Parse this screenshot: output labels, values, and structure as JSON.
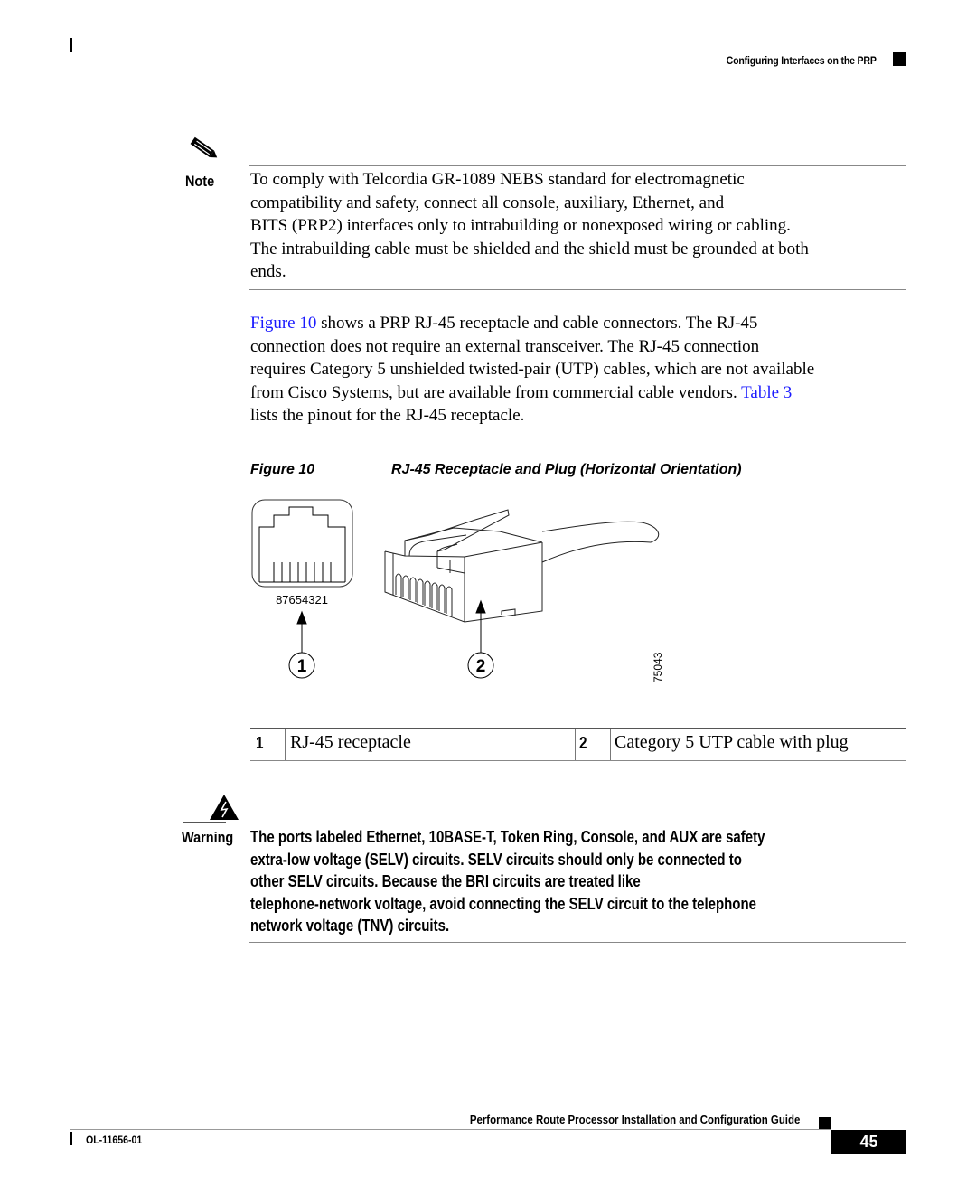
{
  "header": {
    "section_title": "Configuring Interfaces on the PRP"
  },
  "note": {
    "label": "Note",
    "icon": "pencil-icon",
    "lines": [
      "To comply with Telcordia GR-1089 NEBS standard for electromagnetic",
      "compatibility and safety, connect all console, auxiliary, Ethernet, and",
      "BITS (PRP2) interfaces only to intrabuilding or nonexposed wiring or cabling.",
      "The intrabuilding cable must be shielded and the shield must be grounded at both",
      "ends."
    ]
  },
  "paragraph": {
    "figure_link": "Figure 10",
    "line1_rest": " shows a PRP RJ-45 receptacle and cable connectors. The RJ-45",
    "line2": "connection does not require an external transceiver. The RJ-45 connection",
    "line3": "requires Category 5 unshielded twisted-pair (UTP) cables, which are not available",
    "line4_pre": "from Cisco Systems, but are available from commercial cable vendors. ",
    "table_link": "Table 3",
    "line5": "lists the pinout for the RJ-45 receptacle."
  },
  "figure": {
    "number": "Figure 10",
    "title": "RJ-45 Receptacle and Plug (Horizontal Orientation)",
    "pin_numbers": "87654321",
    "callouts": [
      "1",
      "2"
    ],
    "image_id_label": "75043"
  },
  "legend": {
    "items": [
      {
        "num": "1",
        "text": "RJ-45 receptacle"
      },
      {
        "num": "2",
        "text": "Category 5 UTP cable with plug"
      }
    ]
  },
  "warning": {
    "label": "Warning",
    "icon": "electrical-hazard-icon",
    "lines": [
      "The ports labeled Ethernet, 10BASE-T, Token Ring, Console, and AUX are safety",
      "extra-low voltage (SELV) circuits. SELV circuits should only be connected to",
      "other SELV circuits. Because the BRI circuits are treated like",
      "telephone-network voltage, avoid connecting the SELV circuit to the telephone",
      "network voltage (TNV) circuits."
    ]
  },
  "footer": {
    "guide_title": "Performance Route Processor Installation and Configuration Guide",
    "doc_number": "OL-11656-01",
    "page_number": "45"
  }
}
